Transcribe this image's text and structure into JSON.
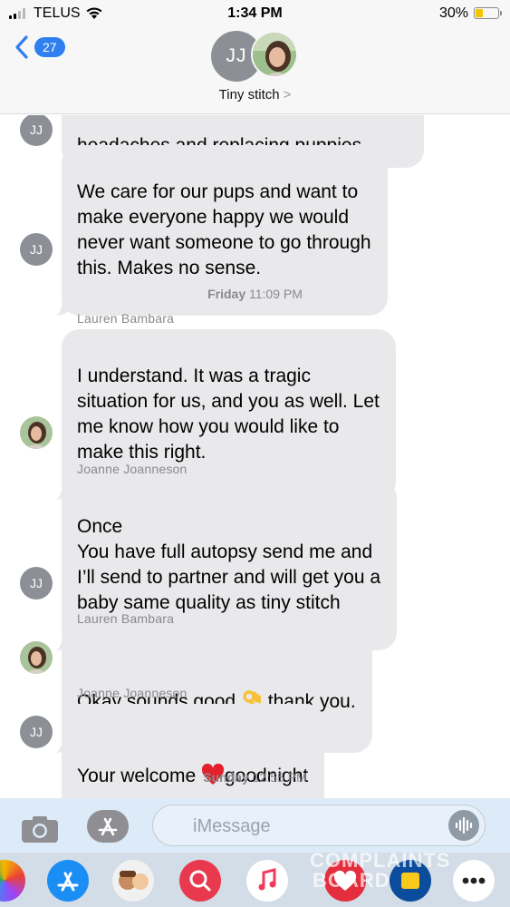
{
  "status_bar": {
    "carrier": "TELUS",
    "time": "1:34 PM",
    "battery_percent": "30%",
    "battery_level": 0.3
  },
  "header": {
    "back_badge": "27",
    "avatar_initials": "JJ",
    "contact_name": "Tiny stitch"
  },
  "messages": [
    {
      "sender": "",
      "avatar": "JJ",
      "text": "headaches and replacing puppies."
    },
    {
      "sender": "",
      "avatar": "JJ",
      "text": "We care for our pups and want to\nmake everyone happy we would\nnever want someone to go through\nthis. Makes no sense."
    },
    {
      "timestamp_day": "Friday",
      "timestamp_time": "11:09 PM"
    },
    {
      "sender": "Lauren Bambara",
      "avatar": "photo",
      "text": "I understand. It was a tragic\nsituation for us, and you as well. Let\nme know how you would like to\nmake this right."
    },
    {
      "sender": "Joanne  Joanneson",
      "avatar": "JJ",
      "text": "Once\nYou have full autopsy send me and\nI’ll send to partner and will get you a\nbaby same quality as tiny stitch"
    },
    {
      "sender": "Lauren Bambara",
      "avatar": "photo",
      "text_before": "Okay sounds good ",
      "emoji": "👌",
      "text_after": " thank you."
    },
    {
      "sender": "Joanne  Joanneson",
      "avatar": "JJ",
      "text_before": "Your welcome ",
      "emoji": "❤️",
      "text_after": "goodnight"
    },
    {
      "timestamp_day": "Sunday",
      "timestamp_time": "12:55 PM"
    }
  ],
  "input": {
    "placeholder": "iMessage"
  },
  "app_drawer": {
    "icons": [
      "photos-icon",
      "app-store-icon",
      "memoji-icon",
      "search-web-icon",
      "music-icon",
      "heart-app-icon",
      "rbc-icon",
      "more-icon"
    ]
  },
  "watermark": {
    "line1": "COMPLAINTS",
    "line2": "BOARD"
  },
  "colors": {
    "bubble_gray": "#e9e9eb",
    "badge_blue": "#2f7ff1",
    "battery_yellow": "#f5c400"
  }
}
